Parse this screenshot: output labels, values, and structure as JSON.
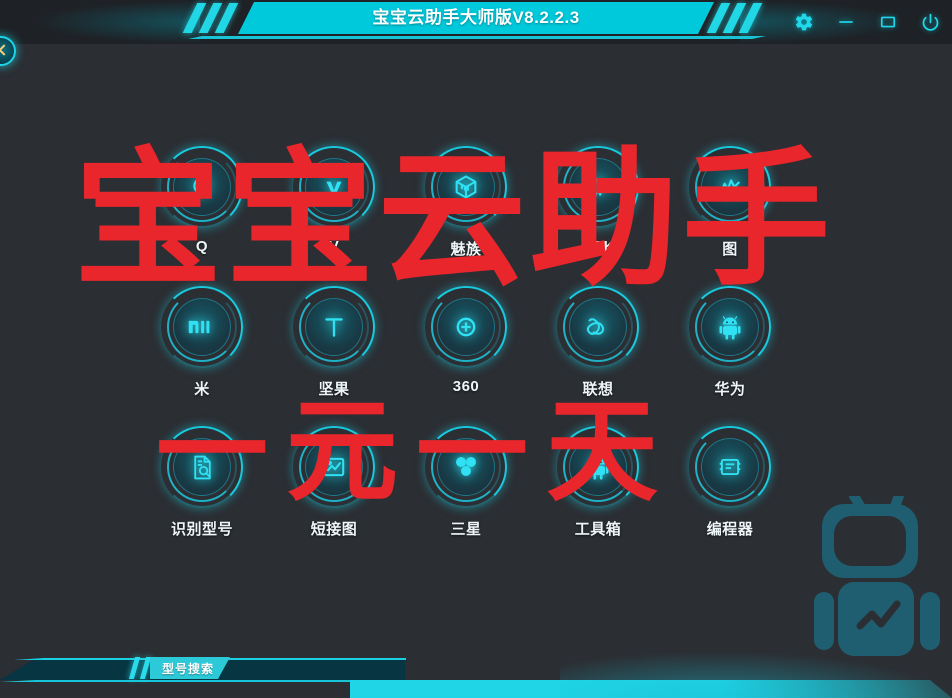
{
  "app": {
    "title": "宝宝云助手大师版V8.2.2.3",
    "background_color": "#2b2e33",
    "accent_color": "#00c9db",
    "watermark_color": "#e8262c",
    "label_color": "#eef6f8"
  },
  "titlebar": {
    "title": "宝宝云助手大师版V8.2.2.3",
    "buttons": [
      {
        "name": "settings-button",
        "icon": "gear-icon",
        "label": "设置"
      },
      {
        "name": "minimize-button",
        "icon": "minimize-icon",
        "label": "最小化"
      },
      {
        "name": "maximize-button",
        "icon": "maximize-icon",
        "label": "最大化"
      },
      {
        "name": "power-button",
        "icon": "power-icon",
        "label": "关闭"
      }
    ]
  },
  "left_badge": {
    "name": "collapse-badge",
    "icon": "chevron-left-icon"
  },
  "grid": {
    "rows": 3,
    "columns": 5,
    "items": [
      {
        "label": "Q",
        "icon": "qq-icon",
        "row": 1,
        "col": 1
      },
      {
        "label": "V",
        "icon": "vivo-icon",
        "row": 1,
        "col": 2
      },
      {
        "label": "魅族",
        "icon": "meizu-cube-icon",
        "row": 1,
        "col": 3
      },
      {
        "label": "MTK",
        "icon": "chip-icon",
        "row": 1,
        "col": 4
      },
      {
        "label": "图",
        "icon": "circuit-chart-icon",
        "row": 1,
        "col": 5
      },
      {
        "label": "米",
        "icon": "mi-icon",
        "row": 2,
        "col": 1
      },
      {
        "label": "坚果",
        "icon": "smartisan-t-icon",
        "row": 2,
        "col": 2
      },
      {
        "label": "360",
        "icon": "target-plus-icon",
        "row": 2,
        "col": 3
      },
      {
        "label": "联想",
        "icon": "lenovo-knot-icon",
        "row": 2,
        "col": 4
      },
      {
        "label": "华为",
        "icon": "android-icon",
        "row": 2,
        "col": 5
      },
      {
        "label": "识别型号",
        "icon": "document-search-icon",
        "row": 3,
        "col": 1
      },
      {
        "label": "短接图",
        "icon": "image-chart-icon",
        "row": 3,
        "col": 2
      },
      {
        "label": "三星",
        "icon": "samsung-dots-icon",
        "row": 3,
        "col": 3
      },
      {
        "label": "工具箱",
        "icon": "android-icon",
        "row": 3,
        "col": 4
      },
      {
        "label": "编程器",
        "icon": "programmer-chip-icon",
        "row": 3,
        "col": 5
      }
    ]
  },
  "watermarks": {
    "line1": "宝宝云助手",
    "line2": "一元一天",
    "mascot": "robot-mascot-icon"
  },
  "bottombar": {
    "tab_label": "型号搜索"
  }
}
